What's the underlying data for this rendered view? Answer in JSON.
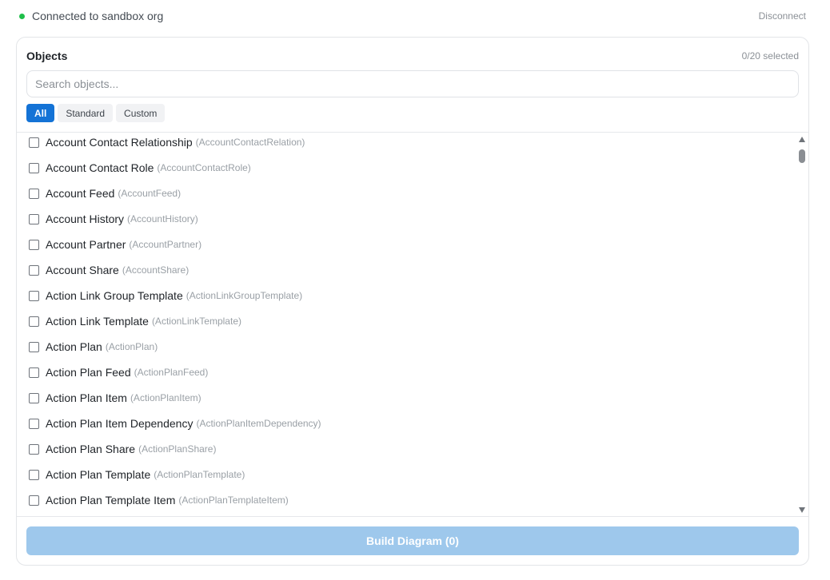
{
  "status": {
    "text": "Connected to sandbox org",
    "dot_color": "#1fbf4a",
    "disconnect_label": "Disconnect"
  },
  "panel": {
    "title": "Objects",
    "selected_count": "0/20 selected",
    "search_placeholder": "Search objects...",
    "filters": [
      {
        "label": "All",
        "active": true
      },
      {
        "label": "Standard",
        "active": false
      },
      {
        "label": "Custom",
        "active": false
      }
    ],
    "objects": [
      {
        "label": "Account Contact Relationship",
        "api": "(AccountContactRelation)",
        "checked": false
      },
      {
        "label": "Account Contact Role",
        "api": "(AccountContactRole)",
        "checked": false
      },
      {
        "label": "Account Feed",
        "api": "(AccountFeed)",
        "checked": false
      },
      {
        "label": "Account History",
        "api": "(AccountHistory)",
        "checked": false
      },
      {
        "label": "Account Partner",
        "api": "(AccountPartner)",
        "checked": false
      },
      {
        "label": "Account Share",
        "api": "(AccountShare)",
        "checked": false
      },
      {
        "label": "Action Link Group Template",
        "api": "(ActionLinkGroupTemplate)",
        "checked": false
      },
      {
        "label": "Action Link Template",
        "api": "(ActionLinkTemplate)",
        "checked": false
      },
      {
        "label": "Action Plan",
        "api": "(ActionPlan)",
        "checked": false
      },
      {
        "label": "Action Plan Feed",
        "api": "(ActionPlanFeed)",
        "checked": false
      },
      {
        "label": "Action Plan Item",
        "api": "(ActionPlanItem)",
        "checked": false
      },
      {
        "label": "Action Plan Item Dependency",
        "api": "(ActionPlanItemDependency)",
        "checked": false
      },
      {
        "label": "Action Plan Share",
        "api": "(ActionPlanShare)",
        "checked": false
      },
      {
        "label": "Action Plan Template",
        "api": "(ActionPlanTemplate)",
        "checked": false
      },
      {
        "label": "Action Plan Template Item",
        "api": "(ActionPlanTemplateItem)",
        "checked": false
      }
    ],
    "build_button_label": "Build Diagram (0)",
    "accent_color": "#1473d6"
  }
}
